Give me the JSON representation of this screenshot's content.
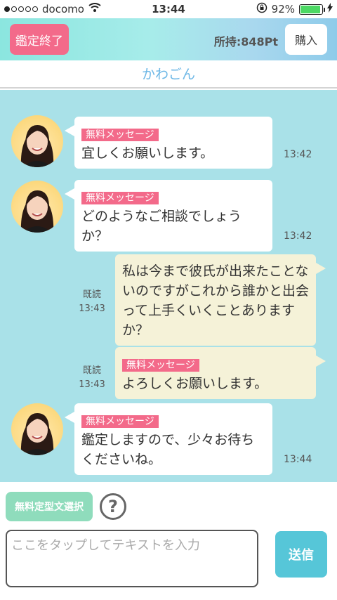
{
  "status_bar": {
    "carrier": "docomo",
    "time": "13:44",
    "battery": "92%",
    "battery_level": 0.92,
    "signal_dots_filled": 1,
    "signal_dots_total": 5
  },
  "header": {
    "end_button": "鑑定終了",
    "points": "所持:848Pt",
    "buy_button": "購入"
  },
  "advisor_name": "かわごん",
  "messages": [
    {
      "tag": "無料メッセージ",
      "text": "宜しくお願いします。",
      "time": "13:42"
    },
    {
      "tag": "無料メッセージ",
      "text": "どのようなご相談でしょうか？",
      "time": "13:42"
    },
    {
      "text": "私は今まで彼氏が出来たことないのですがこれから誰かと出会って上手くいくことありますか？",
      "read": "既読",
      "time": "13:43"
    },
    {
      "tag": "無料メッセージ",
      "text": "よろしくお願いします。",
      "read": "既読",
      "time": "13:43"
    },
    {
      "tag": "無料メッセージ",
      "text": "鑑定しますので、少々お待ちくださいね。",
      "time": "13:44"
    }
  ],
  "footer": {
    "template_button": "無料定型文選択",
    "help_icon": "?",
    "input_placeholder": "ここをタップしてテキストを入力",
    "send_button": "送信"
  },
  "colors": {
    "pink": "#f36a8a",
    "chat_bg": "#a9e1e8",
    "send": "#56c6d8",
    "template": "#8fdcbc"
  }
}
